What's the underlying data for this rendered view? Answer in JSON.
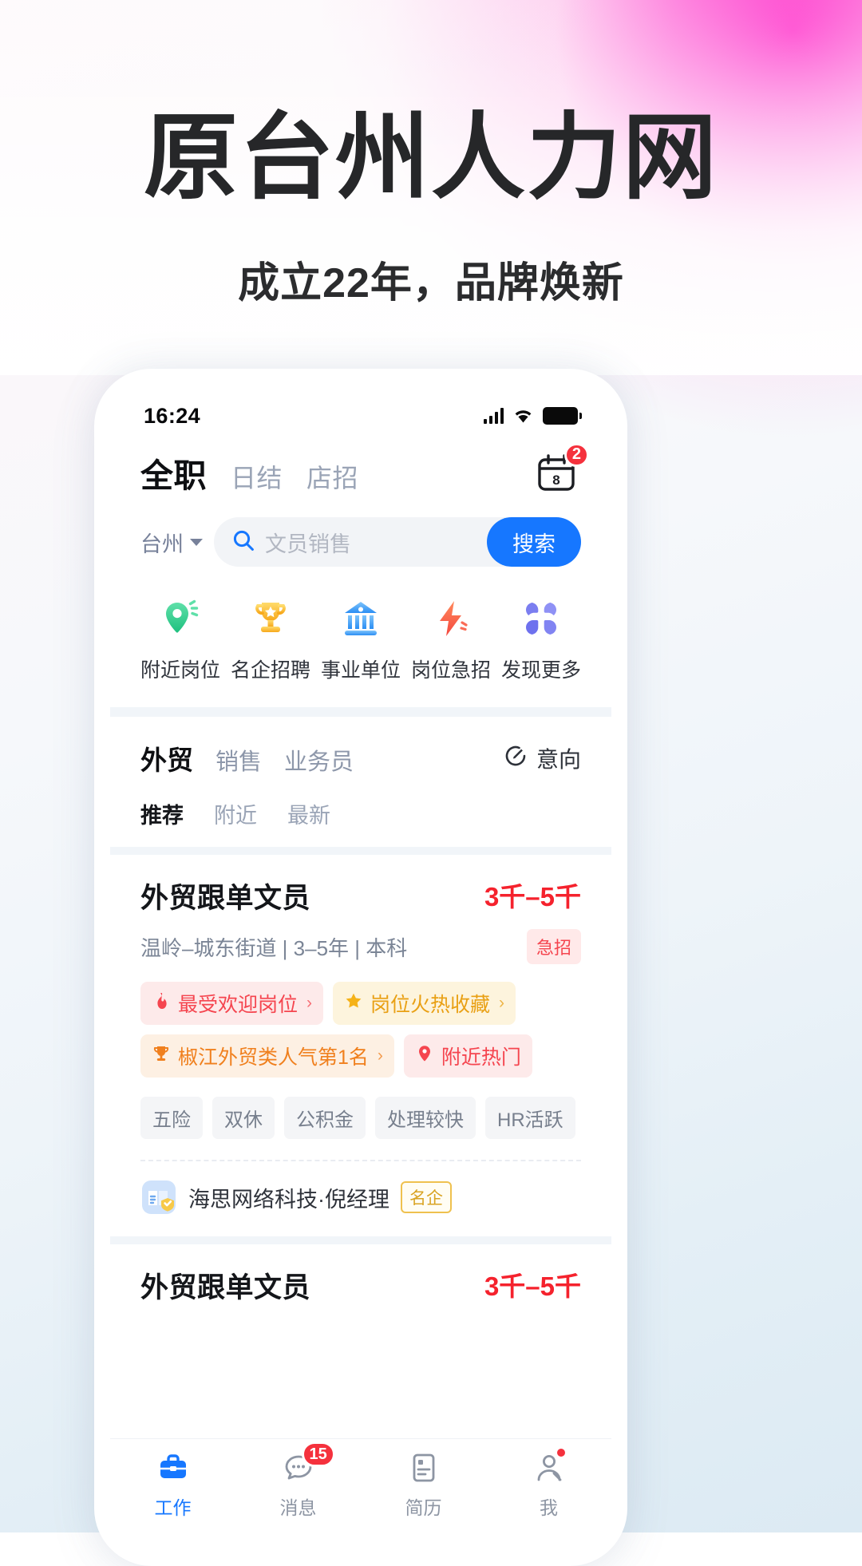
{
  "promo": {
    "title": "原台州人力网",
    "subtitle": "成立22年，品牌焕新"
  },
  "status_bar": {
    "time": "16:24",
    "signal_icon": "signal-bars-icon",
    "wifi_icon": "wifi-icon",
    "battery_icon": "battery-icon"
  },
  "header": {
    "tabs": [
      {
        "label": "全职",
        "active": true
      },
      {
        "label": "日结",
        "active": false
      },
      {
        "label": "店招",
        "active": false
      }
    ],
    "calendar_icon": "calendar-icon",
    "calendar_day": "8",
    "calendar_badge": "2"
  },
  "search": {
    "city": "台州",
    "caret_icon": "chevron-down-icon",
    "search_icon": "search-icon",
    "placeholder": "文员销售",
    "value": "",
    "button_label": "搜索"
  },
  "quick_entries": [
    {
      "label": "附近岗位",
      "icon": "location-pin-icon",
      "color": "#2dd08a"
    },
    {
      "label": "名企招聘",
      "icon": "trophy-icon",
      "color": "#fbc02d"
    },
    {
      "label": "事业单位",
      "icon": "bank-icon",
      "color": "#3da0f7"
    },
    {
      "label": "岗位急招",
      "icon": "lightning-bolt-icon",
      "color": "#fa6b56"
    },
    {
      "label": "发现更多",
      "icon": "grid-four-icon",
      "color": "#7b7ef0"
    }
  ],
  "category": {
    "tabs": [
      {
        "label": "外贸",
        "active": true
      },
      {
        "label": "销售",
        "active": false
      },
      {
        "label": "业务员",
        "active": false
      }
    ],
    "intent_icon": "edit-circle-icon",
    "intent_label": "意向",
    "sorts": [
      {
        "label": "推荐",
        "active": true
      },
      {
        "label": "附近",
        "active": false
      },
      {
        "label": "最新",
        "active": false
      }
    ]
  },
  "jobs": [
    {
      "title": "外贸跟单文员",
      "salary": "3千–5千",
      "meta": "温岭–城东街道 | 3–5年 | 本科",
      "urgent_badge": "急招",
      "highlight_tags": [
        {
          "label": "最受欢迎岗位",
          "icon": "flame-icon",
          "style": "hl-pink",
          "chevron": "›"
        },
        {
          "label": "岗位火热收藏",
          "icon": "star-icon",
          "style": "hl-gold",
          "chevron": "›"
        },
        {
          "label": "椒江外贸类人气第1名",
          "icon": "trophy-icon",
          "style": "hl-orange",
          "chevron": "›"
        },
        {
          "label": "附近热门",
          "icon": "location-pin-icon",
          "style": "hl-red",
          "chevron": ""
        }
      ],
      "welfare_tags": [
        "五险",
        "双休",
        "公积金",
        "处理较快",
        "HR活跃"
      ],
      "company_logo_icon": "company-verified-icon",
      "company": "海思网络科技·倪经理",
      "company_badge": "名企"
    },
    {
      "title": "外贸跟单文员",
      "salary": "3千–5千"
    }
  ],
  "bottom_nav": [
    {
      "label": "工作",
      "icon": "briefcase-icon",
      "active": true,
      "badge": ""
    },
    {
      "label": "消息",
      "icon": "chat-bubble-icon",
      "active": false,
      "badge": "15"
    },
    {
      "label": "简历",
      "icon": "resume-icon",
      "active": false,
      "badge": ""
    },
    {
      "label": "我",
      "icon": "user-icon",
      "active": false,
      "badge": "dot"
    }
  ],
  "colors": {
    "accent": "#1677ff",
    "danger": "#f5313d",
    "salary": "#f5222d",
    "badge_gold": "#e9a014"
  }
}
